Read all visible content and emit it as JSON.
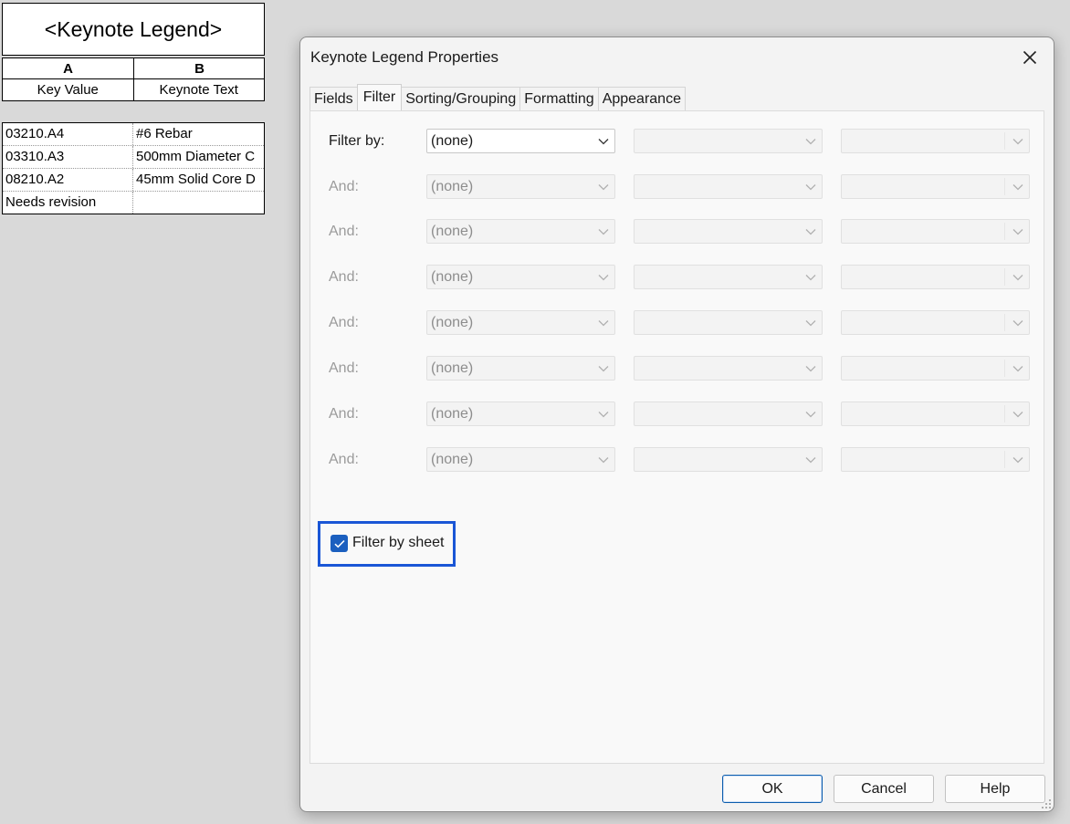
{
  "schedule": {
    "title": "<Keynote Legend>",
    "column_letters": [
      "A",
      "B"
    ],
    "column_headers": [
      "Key Value",
      "Keynote Text"
    ],
    "rows": [
      {
        "key": "03210.A4",
        "text": "#6 Rebar"
      },
      {
        "key": "03310.A3",
        "text": "500mm Diameter C"
      },
      {
        "key": "08210.A2",
        "text": "45mm Solid Core D"
      },
      {
        "key": "Needs revision",
        "text": ""
      }
    ]
  },
  "dialog": {
    "title": "Keynote Legend Properties",
    "close_icon": "close-icon",
    "tabs": [
      {
        "label": "Fields",
        "active": false
      },
      {
        "label": "Filter",
        "active": true
      },
      {
        "label": "Sorting/Grouping",
        "active": false
      },
      {
        "label": "Formatting",
        "active": false
      },
      {
        "label": "Appearance",
        "active": false
      }
    ],
    "filter_rows": [
      {
        "label": "Filter by:",
        "field": "(none)",
        "enabled": true
      },
      {
        "label": "And:",
        "field": "(none)",
        "enabled": false
      },
      {
        "label": "And:",
        "field": "(none)",
        "enabled": false
      },
      {
        "label": "And:",
        "field": "(none)",
        "enabled": false
      },
      {
        "label": "And:",
        "field": "(none)",
        "enabled": false
      },
      {
        "label": "And:",
        "field": "(none)",
        "enabled": false
      },
      {
        "label": "And:",
        "field": "(none)",
        "enabled": false
      },
      {
        "label": "And:",
        "field": "(none)",
        "enabled": false
      }
    ],
    "filter_by_sheet": {
      "label": "Filter by sheet",
      "checked": true
    },
    "buttons": {
      "ok": "OK",
      "cancel": "Cancel",
      "help": "Help"
    }
  },
  "colors": {
    "accent": "#1b5fbf",
    "highlight_border": "#1a56d6",
    "background": "#d9d9d9"
  }
}
